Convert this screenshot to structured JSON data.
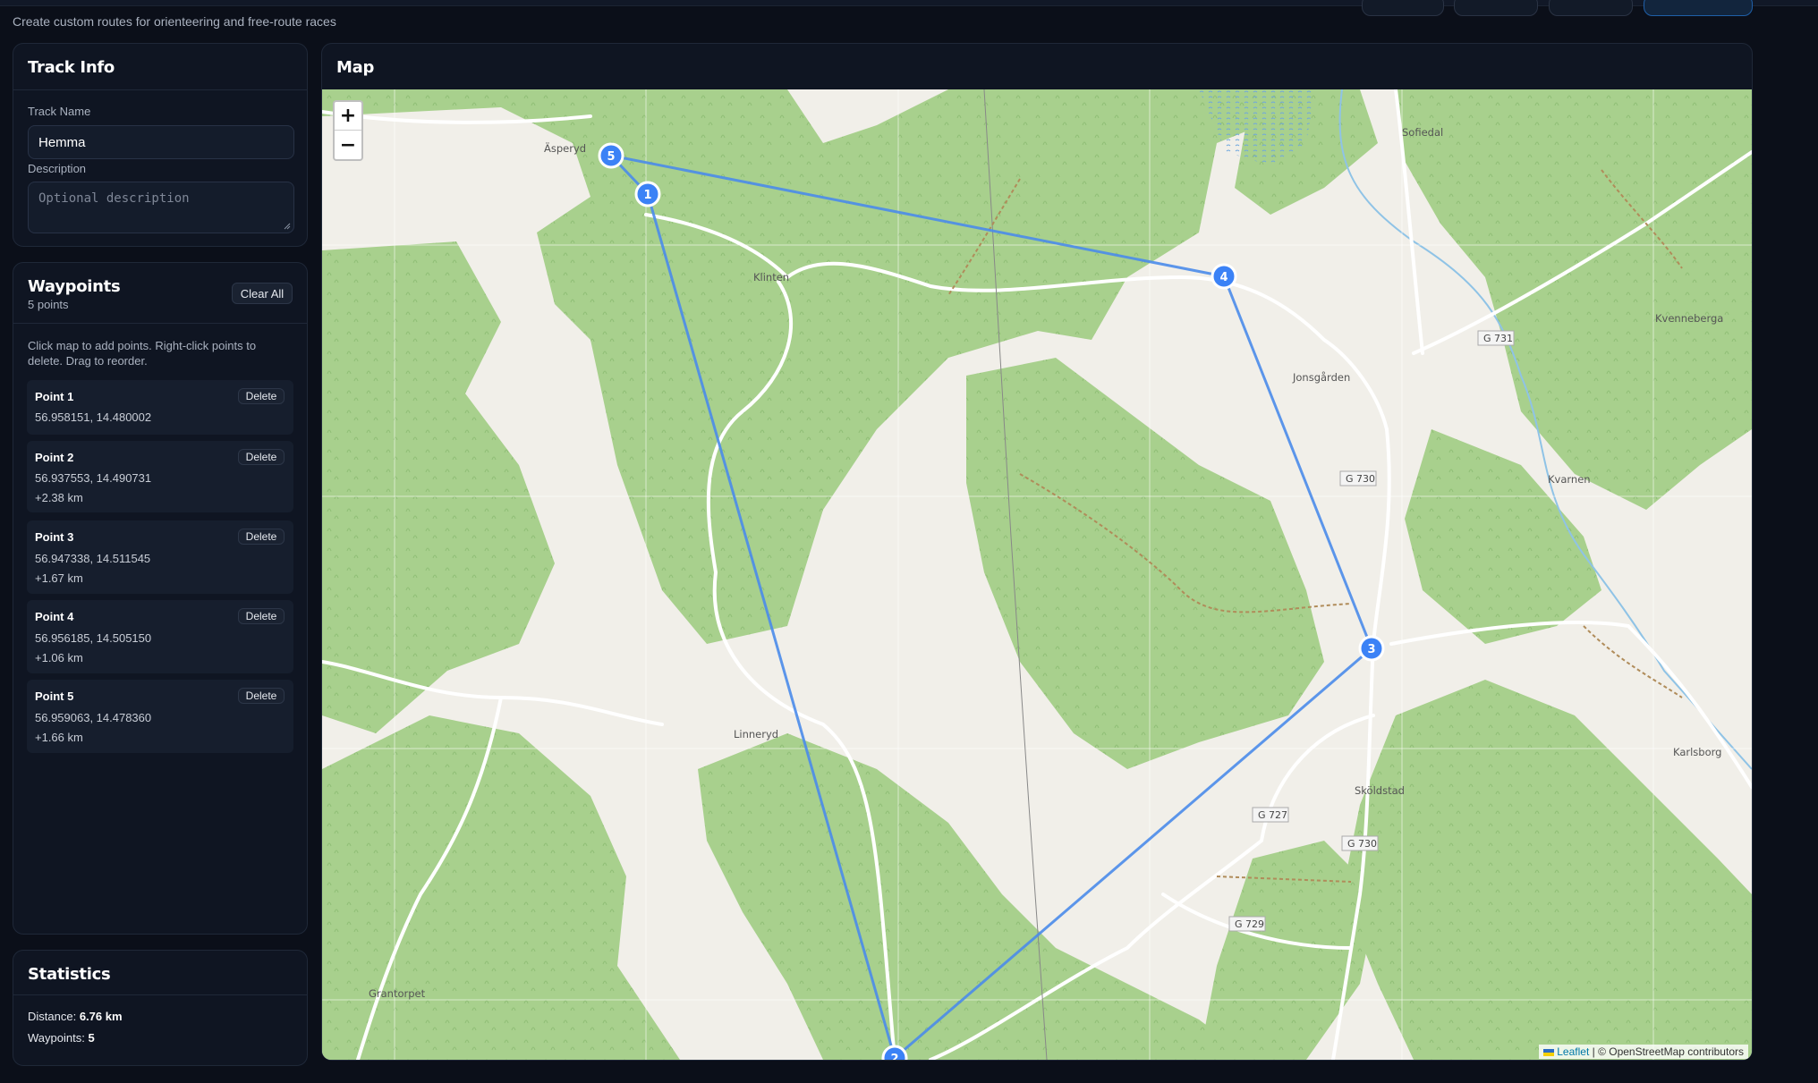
{
  "header": {
    "subtitle": "Create custom routes for orienteering and free-route races"
  },
  "track_info": {
    "title": "Track Info",
    "name_label": "Track Name",
    "name_value": "Hemma",
    "description_label": "Description",
    "description_placeholder": "Optional description"
  },
  "waypoints": {
    "title": "Waypoints",
    "count_text": "5 points",
    "clear_label": "Clear All",
    "help_text": "Click map to add points. Right-click points to delete. Drag to reorder.",
    "delete_label": "Delete",
    "items": [
      {
        "name": "Point 1",
        "coords": "56.958151, 14.480002",
        "delta": ""
      },
      {
        "name": "Point 2",
        "coords": "56.937553, 14.490731",
        "delta": "+2.38 km"
      },
      {
        "name": "Point 3",
        "coords": "56.947338, 14.511545",
        "delta": "+1.67 km"
      },
      {
        "name": "Point 4",
        "coords": "56.956185, 14.505150",
        "delta": "+1.06 km"
      },
      {
        "name": "Point 5",
        "coords": "56.959063, 14.478360",
        "delta": "+1.66 km"
      }
    ]
  },
  "statistics": {
    "title": "Statistics",
    "distance_label": "Distance:",
    "distance_value": "6.76 km",
    "waypoints_label": "Waypoints:",
    "waypoints_value": "5"
  },
  "map": {
    "title": "Map",
    "zoom_in": "+",
    "zoom_out": "−",
    "attribution_link": "Leaflet",
    "attribution_text": " | © OpenStreetMap contributors",
    "route_color": "#4a8bea",
    "marker_color": "#3b82f6",
    "markers": [
      "1",
      "2",
      "3",
      "4",
      "5"
    ],
    "places": [
      "Äsperyd",
      "Klinten",
      "Sofiedal",
      "Kvenneberga",
      "Jonsgården",
      "Kvarnen",
      "Linneryd",
      "Sköldstad",
      "Karlsborg",
      "Grantorpet"
    ],
    "roads": [
      "G 731",
      "G 730",
      "G 727",
      "G 730",
      "G 729"
    ]
  }
}
